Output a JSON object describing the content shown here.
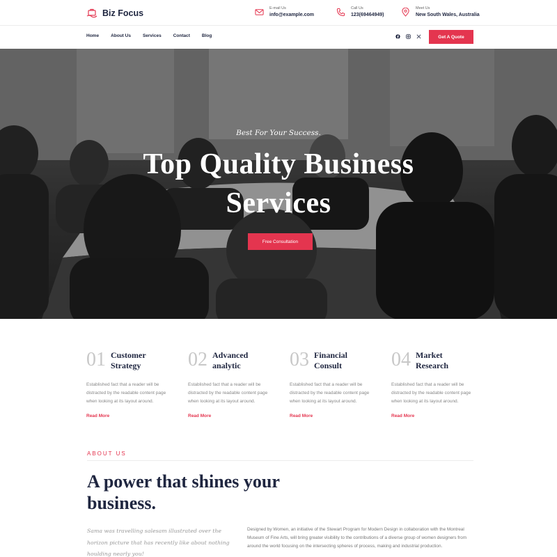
{
  "brand": {
    "name": "Biz Focus",
    "accent": "#e4354f",
    "dark": "#1f2640"
  },
  "contacts": {
    "email": {
      "label": "E-mail Us",
      "value": "info@example.com",
      "icon": "mail-icon"
    },
    "call": {
      "label": "Call Us",
      "value": "123(69464949)",
      "icon": "phone-icon"
    },
    "meet": {
      "label": "Meet Us",
      "value": "New South Wales, Australia",
      "icon": "location-pin-icon"
    }
  },
  "nav": {
    "items": [
      "Home",
      "About Us",
      "Services",
      "Contact",
      "Blog"
    ],
    "socials": [
      "facebook-icon",
      "instagram-icon",
      "x-icon"
    ],
    "cta": "Get A Quote"
  },
  "hero": {
    "kicker": "Best For Your Success.",
    "title": "Top Quality Business Services",
    "button": "Free Consultation"
  },
  "services": [
    {
      "num": "01",
      "title_line1": "Customer",
      "title_line2": "Strategy",
      "desc": "Established fact that a reader will be distracted by the readable content page when looking at its layout around.",
      "link": "Read More"
    },
    {
      "num": "02",
      "title_line1": "Advanced",
      "title_line2": "analytic",
      "desc": "Established fact that a reader will be distracted by the readable content page when looking at its layout around.",
      "link": "Read More"
    },
    {
      "num": "03",
      "title_line1": "Financial",
      "title_line2": "Consult",
      "desc": "Established fact that a reader will be distracted by the readable content page when looking at its layout around.",
      "link": "Read More"
    },
    {
      "num": "04",
      "title_line1": "Market",
      "title_line2": "Research",
      "desc": "Established fact that a reader will be distracted by the readable content page when looking at its layout around.",
      "link": "Read More"
    }
  ],
  "about": {
    "kicker": "ABOUT US",
    "title": "A power that shines your business.",
    "quote": "Sama was travelling salesam illustrated over the horizon picture that has recently like about nothing houlding nearly you!",
    "body": "Designed by Women, an initiative of the Stewart Program for Modern Design in collaboration with the Montreal Museum of Fine Arts, will bring greater visibility to the contributions of a diverse group of women designers from around the world focusing on the intersecting spheres of process, making and industrial production."
  }
}
